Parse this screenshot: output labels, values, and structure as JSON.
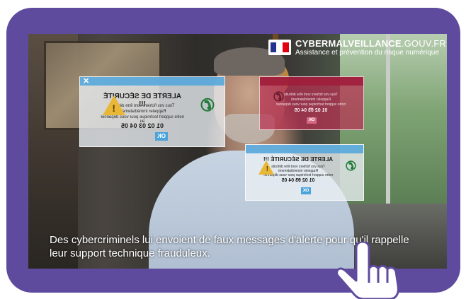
{
  "brand": {
    "name_bold": "CYBERMALVEILLANCE",
    "name_suffix": ".GOUV.FR",
    "tagline": "Assistance et prévention du risque numérique",
    "flag_colors": [
      "#24318f",
      "#ffffff",
      "#e1000f"
    ]
  },
  "popups": [
    {
      "title": "ALERTE DE SÉCURITÉ !!!",
      "lines": [
        "Tous vos fichiers vont être détruits",
        "Rappeler immédiatement",
        "notre support technique pour vous dépanner au"
      ],
      "phone": "01 02 03 04 05",
      "ok_label": "OK",
      "close_label": "✕",
      "icons": [
        "phone-icon",
        "warning-icon"
      ]
    },
    {
      "lines": [
        "Tous vos fichiers vont être détruits",
        "Rappeler immédiatement",
        "notre support technique pour vous dépanner au"
      ],
      "phone": "01 02 03 04 05",
      "ok_label": "OK",
      "icons": [
        "phone-icon"
      ]
    },
    {
      "title": "ALERTE DE SÉCURITÉ !!!",
      "lines": [
        "Tous vos fichiers vont être détruits",
        "Rappeler immédiatement",
        "notre support technique pour vous dépanner au"
      ],
      "phone": "01 02 03 04 05",
      "ok_label": "OK",
      "icons": [
        "phone-icon",
        "warning-icon"
      ]
    }
  ],
  "subtitle": "Des cybercriminels lui envoient de faux messages d'alerte pour qu'il rappelle leur support technique frauduleux.",
  "colors": {
    "frame": "#5f4b9e",
    "popup_bar": "#50a5dc",
    "popup_alt": "#b83052",
    "warning": "#e8b735"
  },
  "cursor_icon": "hand-pointer-icon"
}
